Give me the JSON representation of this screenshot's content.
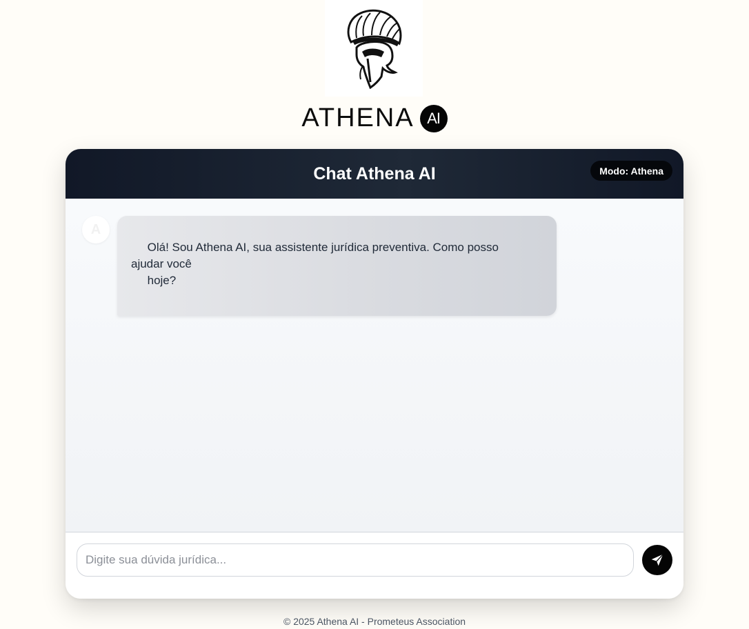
{
  "brand": {
    "name": "ATHENA",
    "badge": "AI",
    "logo_icon": "spartan-helmet-icon"
  },
  "chat": {
    "title": "Chat Athena AI",
    "mode_badge": "Modo: Athena",
    "messages": [
      {
        "sender": "bot",
        "avatar_letter": "A",
        "lines": [
          "     Olá! Sou Athena AI, sua assistente jurídica preventiva. Como posso",
          "ajudar você",
          "     hoje?"
        ]
      }
    ]
  },
  "composer": {
    "placeholder": "Digite sua dúvida jurídica...",
    "value": "",
    "send_icon": "paper-plane-icon"
  },
  "footer": {
    "text": "© 2025 Athena AI - Prometeus Association"
  },
  "colors": {
    "page_background": "#fffdf8",
    "header_dark": "#111827",
    "accent_black": "#050505",
    "bubble_gray": "#d9dbe0"
  }
}
